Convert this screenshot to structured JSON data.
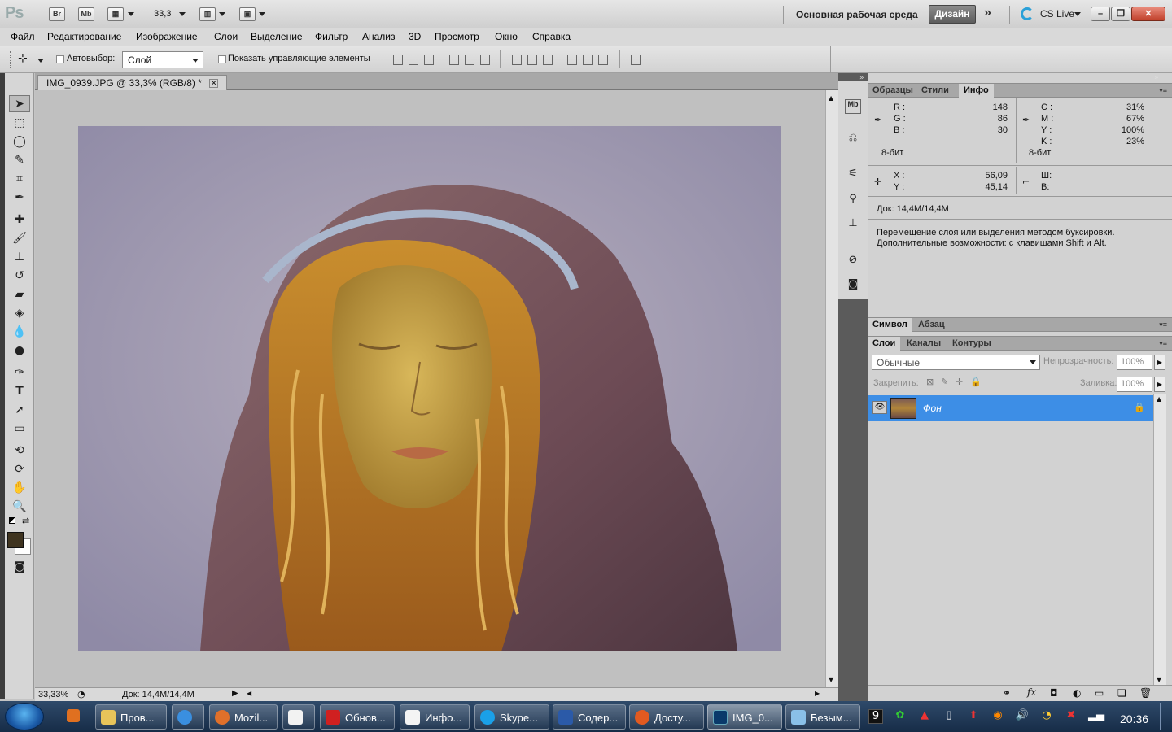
{
  "appbar": {
    "logo": "Ps",
    "bridge": "Br",
    "minibridge": "Mb",
    "zoom": "33,3",
    "workspace_label": "Основная рабочая среда",
    "workspace_button": "Дизайн",
    "more": "»",
    "cslive": "CS Live",
    "win_min": "–",
    "win_restore": "❐",
    "win_close": "✕"
  },
  "menu": [
    "Файл",
    "Редактирование",
    "Изображение",
    "Слои",
    "Выделение",
    "Фильтр",
    "Анализ",
    "3D",
    "Просмотр",
    "Окно",
    "Справка"
  ],
  "options": {
    "autoselect_label": "Автовыбор:",
    "autoselect_value": "Слой",
    "show_controls_label": "Показать управляющие элементы"
  },
  "document": {
    "tab_title": "IMG_0939.JPG @ 33,3% (RGB/8) *",
    "tab_close": "✕"
  },
  "status": {
    "zoom": "33,33%",
    "doc": "Док: 14,4M/14,4M"
  },
  "info_panel": {
    "tabs": [
      "Образцы",
      "Стили",
      "Инфо"
    ],
    "active_tab": "Инфо",
    "rgb": {
      "R": "148",
      "G": "86",
      "B": "30",
      "bits": "8-бит"
    },
    "cmyk": {
      "C": "31%",
      "M": "67%",
      "Y": "100%",
      "K": "23%",
      "bits": "8-бит"
    },
    "xy": {
      "X": "56,09",
      "Y": "45,14"
    },
    "wh": {
      "W_label": "Ш:",
      "H_label": "В:"
    },
    "doc": "Док: 14,4M/14,4M",
    "hint_line1": "Перемещение слоя или выделения методом буксировки.",
    "hint_line2": "Дополнительные возможности: с клавишами Shift и Alt."
  },
  "char_panel": {
    "tabs": [
      "Символ",
      "Абзац"
    ]
  },
  "layers_panel": {
    "tabs": [
      "Слои",
      "Каналы",
      "Контуры"
    ],
    "blend_mode": "Обычные",
    "opacity_label": "Непрозрачность:",
    "opacity_value": "100%",
    "lock_label": "Закрепить:",
    "fill_label": "Заливка:",
    "fill_value": "100%",
    "layers": [
      {
        "name": "Фон",
        "selected": true,
        "locked": true
      }
    ]
  },
  "taskbar": {
    "tasks": [
      "Пров...",
      "",
      "Mozil...",
      "",
      "Обнов...",
      "Инфо...",
      "Skype...",
      "Содер...",
      "Досту...",
      "IMG_0...",
      "Безым..."
    ],
    "clock": "20:36"
  },
  "colors": {
    "accent_layer": "#3d8ee6",
    "foreground": "#3f3420",
    "background": "#ffffff"
  }
}
